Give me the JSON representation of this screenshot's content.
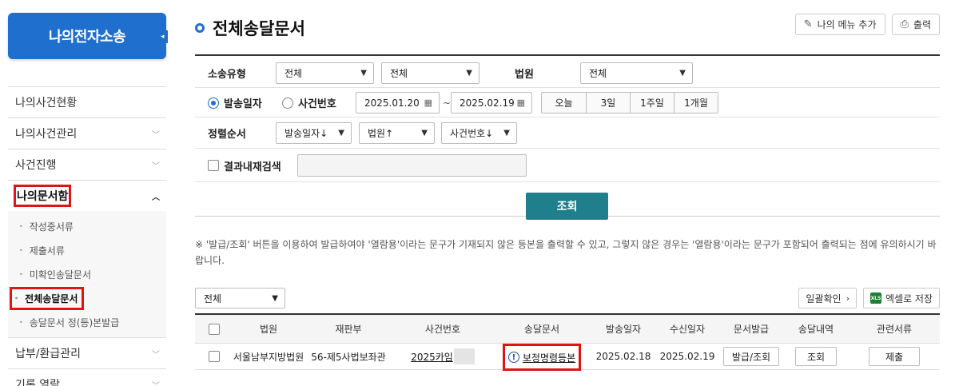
{
  "sidebar": {
    "brand": "나의전자소송",
    "items": [
      {
        "label": "나의사건현황",
        "chevron": ""
      },
      {
        "label": "나의사건관리",
        "chevron": "⌄"
      },
      {
        "label": "사건진행",
        "chevron": "⌄"
      },
      {
        "label": "나의문서함",
        "chevron": "⌃"
      }
    ],
    "sub_items": [
      {
        "label": "작성중서류"
      },
      {
        "label": "제출서류"
      },
      {
        "label": "미확인송달문서"
      },
      {
        "label": "전체송달문서"
      },
      {
        "label": "송달문서 정(등)본발급"
      }
    ],
    "items_after": [
      {
        "label": "납부/환급관리",
        "chevron": "⌄"
      },
      {
        "label": "기록 열람",
        "chevron": "⌄"
      }
    ]
  },
  "header": {
    "title": "전체송달문서",
    "add_menu_label": "나의 메뉴 추가",
    "print_label": "출력"
  },
  "search": {
    "type_label": "소송유형",
    "type_value1": "전체",
    "type_value2": "전체",
    "court_label": "법원",
    "court_value": "전체",
    "radio_send": "발송일자",
    "radio_case": "사건번호",
    "date_from": "2025.01.20",
    "date_sep": "~",
    "date_to": "2025.02.19",
    "periods": [
      "오늘",
      "3일",
      "1주일",
      "1개월"
    ],
    "sort_label": "정렬순서",
    "sort1": "발송일자↓",
    "sort2": "법원↑",
    "sort3": "사건번호↓",
    "within_label": "결과내재검색",
    "within_value": "",
    "search_button": "조회"
  },
  "notice": "※ '발급/조회' 버튼을 이용하여 발급하여야 '열람용'이라는 문구가 기재되지 않은 등본을 출력할 수 있고, 그렇지 않은 경우는 '열람용'이라는 문구가 포함되어 출력되는 점에 유의하시기 바랍니다.",
  "list": {
    "filter_value": "전체",
    "bulk_confirm": "일괄확인",
    "excel_save": "엑셀로 저장",
    "columns": [
      "법원",
      "재판부",
      "사건번호",
      "송달문서",
      "발송일자",
      "수신일자",
      "문서발급",
      "송달내역",
      "관련서류"
    ],
    "rows": [
      {
        "court": "서울남부지방법원",
        "division": "56-제5사법보좌관",
        "case_no": "2025카임",
        "document": "보정명령등본",
        "sent": "2025.02.18",
        "received": "2025.02.19",
        "issue_btn": "발급/조회",
        "history_btn": "조회",
        "related_btn": "제출"
      }
    ]
  },
  "colors": {
    "brand": "#1f6fce",
    "search_btn": "#1f7f8d",
    "highlight": "#e01414"
  }
}
